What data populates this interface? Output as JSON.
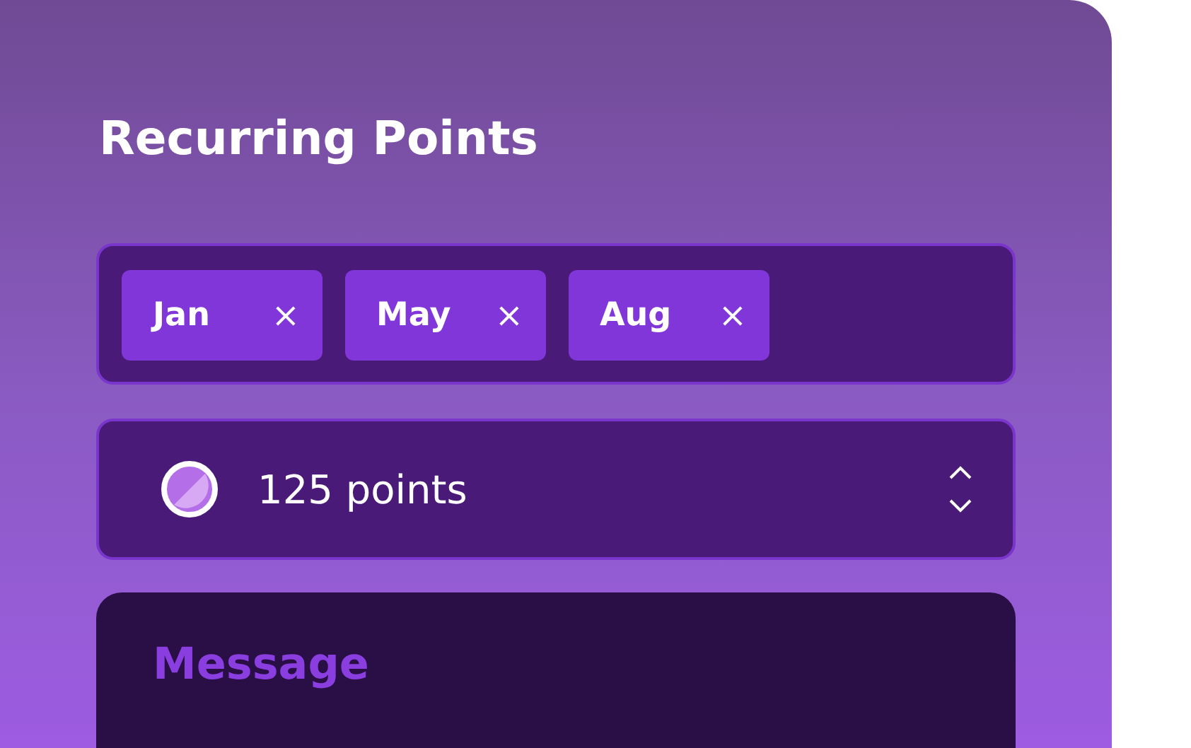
{
  "title": "Recurring Points",
  "months": [
    {
      "label": "Jan",
      "remove": "×"
    },
    {
      "label": "May",
      "remove": "×"
    },
    {
      "label": "Aug",
      "remove": "×"
    }
  ],
  "points_select": {
    "value": "125 points"
  },
  "message": {
    "placeholder": "Message"
  }
}
